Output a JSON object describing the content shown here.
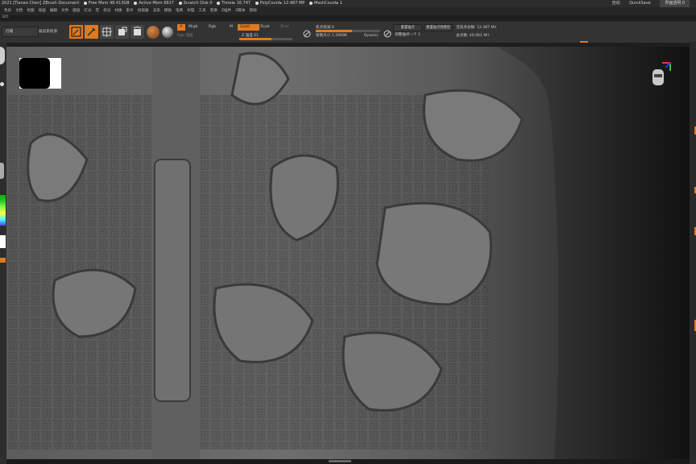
{
  "titlebar": {
    "app_title": "2021 [Tianao Chen]  ZBrush Document",
    "stats": [
      "Free Mem 48.413GB",
      "Active Mem 6827",
      "Scratch Disk 0",
      "Timer▸ 16.747",
      "PolyCount▸ 12.487 MP",
      "MeshCount▸ 1"
    ],
    "autosave_label": "自动",
    "quicksave_label": "QuickSave",
    "transparency_label": "界面透明 0"
  },
  "menu_items": [
    "色彩",
    "文档",
    "绘图",
    "动画",
    "编辑",
    "文件",
    "图层",
    "灯光",
    "宏",
    "标记",
    "材质",
    "影片",
    "拾取器",
    "渲染",
    "模板",
    "笔刷",
    "纹理",
    "工具",
    "变换",
    "Z插件",
    "Z脚本",
    "帮助"
  ],
  "subline_text": "345",
  "toolbar": {
    "lightbox_label": "灯箱",
    "preview_label": "展览系统源",
    "edit_label": "Edit",
    "draw_label": "Draw",
    "move_label": "移动",
    "scale_label": "缩放",
    "rotate_label": "旋转",
    "a_label": "A",
    "mrgb_label": "Mrgb",
    "rgb_label": "Rgb",
    "m_label": "M",
    "zadd_label": "Zadd",
    "zsub_label": "Zsub",
    "zcut_label": "Zcut",
    "rgb_intensity_label": "Rgb 强度",
    "z_intensity_label": "Z 强度 61",
    "z_intensity_value": 61,
    "focal_shift_label": "焦点衰减 0",
    "draw_size_label": "绘制大小 1.29696",
    "dynamic_label": "Dynamic",
    "active_points_label": "活动点总数: 12.487 Mil",
    "total_points_label": "总点数: 40.061 Mil",
    "backface_label": "重置轴点",
    "backface2_label": "重置轴点到模型",
    "adjust_label": "调整轴点一个 1"
  },
  "colors": {
    "accent": "#e07a20",
    "panel": "#333333",
    "canvas": "#4a4a4a"
  }
}
